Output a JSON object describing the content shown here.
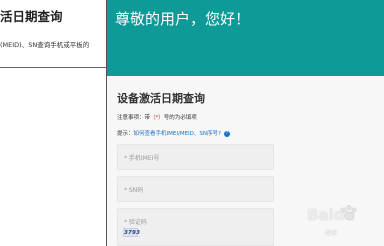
{
  "left_panel": {
    "title": "活日期查询",
    "description": "(MEID)、SN查询手机或平板的"
  },
  "banner": {
    "greeting": "尊敬的用户，您好！",
    "color": "#0e9a96"
  },
  "form": {
    "title": "设备激活日期查询",
    "note_prefix": "注意事项：带",
    "note_star": "（*）",
    "note_suffix": "号的为必填项",
    "tip_label": "提示：",
    "tip_link": "如何查看手机IMEI/MEID、SN序号?",
    "help_icon_glyph": "?",
    "fields": {
      "imei_placeholder": "* 手机IMEI号",
      "sn_placeholder": "* SN码",
      "captcha_placeholder": "* 验证码"
    },
    "captcha_text": "3793"
  },
  "watermark": {
    "logo_text": "Baidu",
    "sub_text": "经验"
  }
}
